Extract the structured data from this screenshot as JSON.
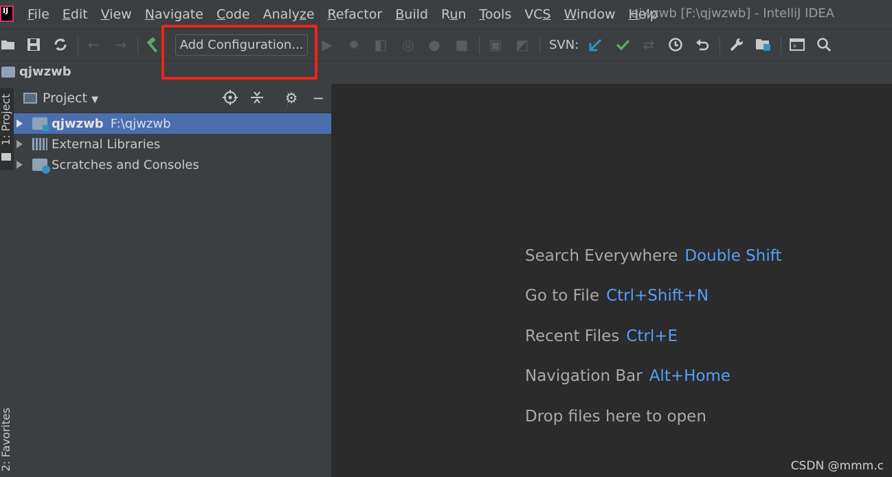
{
  "menubar": {
    "items": [
      {
        "pre": "",
        "mn": "F",
        "post": "ile"
      },
      {
        "pre": "",
        "mn": "E",
        "post": "dit"
      },
      {
        "pre": "",
        "mn": "V",
        "post": "iew"
      },
      {
        "pre": "",
        "mn": "N",
        "post": "avigate"
      },
      {
        "pre": "",
        "mn": "C",
        "post": "ode"
      },
      {
        "pre": "Analy",
        "mn": "z",
        "post": "e"
      },
      {
        "pre": "",
        "mn": "R",
        "post": "efactor"
      },
      {
        "pre": "",
        "mn": "B",
        "post": "uild"
      },
      {
        "pre": "R",
        "mn": "u",
        "post": "n"
      },
      {
        "pre": "",
        "mn": "T",
        "post": "ools"
      },
      {
        "pre": "VC",
        "mn": "S",
        "post": ""
      },
      {
        "pre": "",
        "mn": "W",
        "post": "indow"
      },
      {
        "pre": "",
        "mn": "H",
        "post": "elp"
      }
    ],
    "window_title": "qjwzwb [F:\\qjwzwb] - IntelliJ IDEA",
    "logo_text": "IJ"
  },
  "toolbar": {
    "add_configuration": "Add Configuration...",
    "svn_label": "SVN:",
    "icons": [
      "open-folder-icon",
      "save-icon",
      "sync-icon",
      "back-arrow-icon",
      "forward-arrow-icon",
      "build-hammer-icon",
      "run-icon",
      "debug-icon",
      "coverage-icon",
      "profile-icon",
      "attach-icon",
      "stop-icon",
      "build-artifact-icon",
      "deploy-icon",
      "svn-update-icon",
      "svn-commit-icon",
      "svn-compare-icon",
      "history-icon",
      "revert-icon",
      "settings-wrench-icon",
      "project-structure-icon",
      "terminal-icon",
      "search-icon"
    ]
  },
  "navbar": {
    "project": "qjwzwb"
  },
  "leftstrip": {
    "project_tab": "1: Project",
    "favorites_tab": "2: Favorites"
  },
  "project_panel": {
    "title": "Project",
    "tree": [
      {
        "label": "qjwzwb",
        "path": "F:\\qjwzwb",
        "selected": true
      },
      {
        "label": "External Libraries",
        "path": "",
        "selected": false
      },
      {
        "label": "Scratches and Consoles",
        "path": "",
        "selected": false
      }
    ]
  },
  "editor": {
    "hints": [
      {
        "text": "Search Everywhere",
        "key": "Double Shift"
      },
      {
        "text": "Go to File",
        "key": "Ctrl+Shift+N"
      },
      {
        "text": "Recent Files",
        "key": "Ctrl+E"
      },
      {
        "text": "Navigation Bar",
        "key": "Alt+Home"
      },
      {
        "text": "Drop files here to open",
        "key": ""
      }
    ],
    "watermark": "CSDN @mmm.c"
  },
  "colors": {
    "accent_blue": "#589df6",
    "selection": "#4b6eaf",
    "highlight_red": "#e8251e",
    "svn_green": "#59a869",
    "svn_blue": "#3592c4"
  }
}
